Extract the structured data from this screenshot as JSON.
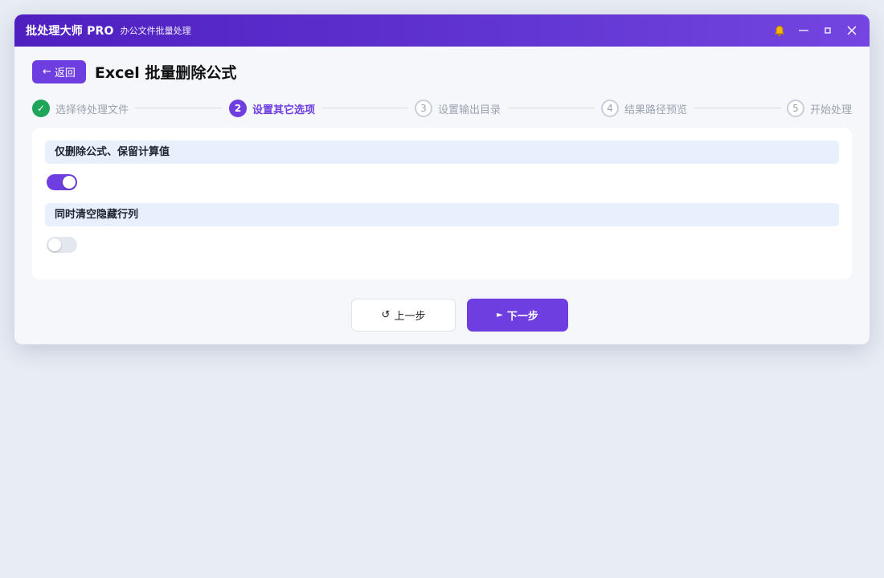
{
  "app": {
    "name": "批处理大师 PRO",
    "subtitle": "办公文件批量处理"
  },
  "titlebar_icons": [
    "bell-icon",
    "minimize-icon",
    "maximize-icon",
    "close-icon"
  ],
  "header": {
    "back_label": "返回",
    "back_arrow": "←",
    "title": "Excel 批量删除公式"
  },
  "steps": [
    {
      "number": "✓",
      "label": "选择待处理文件",
      "state": "done"
    },
    {
      "number": "2",
      "label": "设置其它选项",
      "state": "active"
    },
    {
      "number": "3",
      "label": "设置输出目录",
      "state": "todo"
    },
    {
      "number": "4",
      "label": "结果路径预览",
      "state": "todo"
    },
    {
      "number": "5",
      "label": "开始处理",
      "state": "todo"
    }
  ],
  "options": [
    {
      "label": "仅删除公式、保留计算值",
      "enabled": true
    },
    {
      "label": "同时清空隐藏行列",
      "enabled": false
    }
  ],
  "footer": {
    "prev_icon": "↺",
    "prev_label": "上一步",
    "next_icon": "►",
    "next_label": "下一步"
  },
  "colors": {
    "accent": "#6e3ee0",
    "done": "#1fa55a",
    "bell": "#f5b700"
  }
}
